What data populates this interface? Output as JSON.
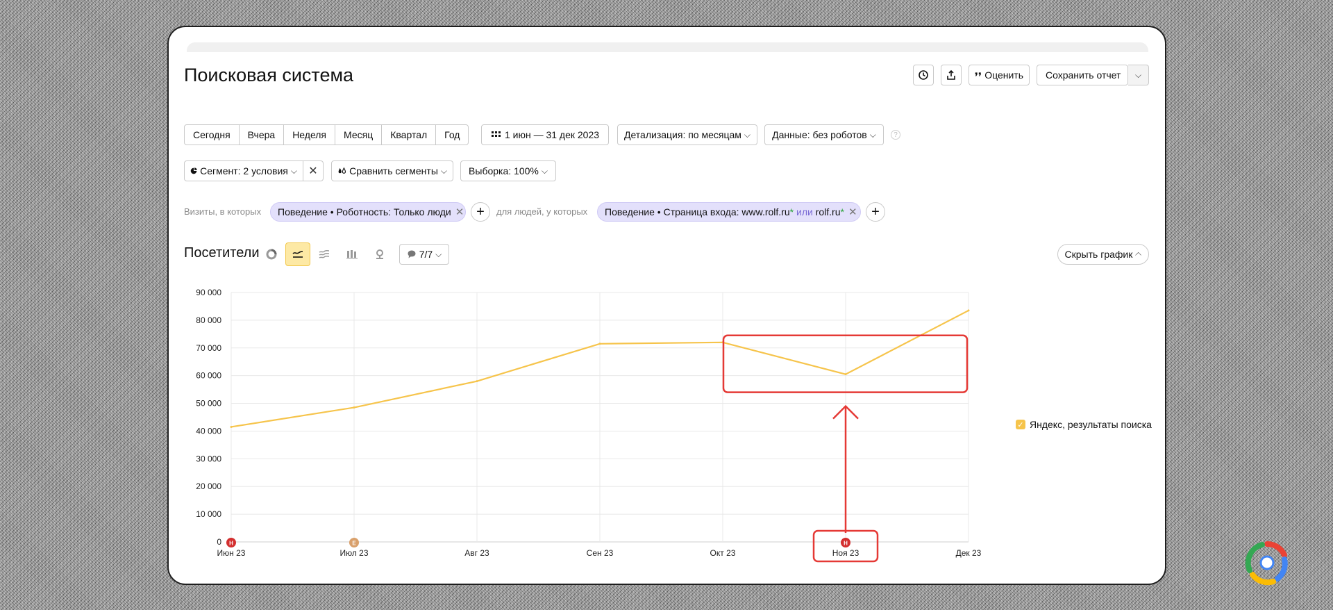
{
  "header": {
    "title": "Поисковая система",
    "rate_label": "Оценить",
    "save_label": "Сохранить отчет",
    "icons": [
      "history-icon",
      "export-icon",
      "rate-icon",
      "chevron-down-icon"
    ]
  },
  "toolbar": {
    "periods": [
      "Сегодня",
      "Вчера",
      "Неделя",
      "Месяц",
      "Квартал",
      "Год"
    ],
    "date_range": "1 июн — 31 дек 2023",
    "detail": "Детализация: по месяцам",
    "data_mode": "Данные: без роботов"
  },
  "segment": {
    "label": "Сегмент: 2 условия",
    "compare": "Сравнить сегменты",
    "sample": "Выборка: 100%"
  },
  "filters": {
    "prefix1": "Визиты, в которых",
    "chip1": "Поведение • Роботность: Только люди",
    "prefix2": "для людей, у которых",
    "chip2_a": "Поведение • Страница входа: www.rolf.ru",
    "chip2_star1": "*",
    "chip2_or": " или ",
    "chip2_b": "rolf.ru",
    "chip2_star2": "*"
  },
  "chart_section": {
    "title": "Посетители",
    "annotations_count": "7/7",
    "hide_label": "Скрыть график",
    "legend": "Яндекс, результаты поиска",
    "series_color": "#f6c44b",
    "highlight_color": "#e53935"
  },
  "chart_data": {
    "type": "line",
    "categories": [
      "Июн 23",
      "Июл 23",
      "Авг 23",
      "Сен 23",
      "Окт 23",
      "Ноя 23",
      "Дек 23"
    ],
    "y_ticks": [
      "0",
      "10 000",
      "20 000",
      "30 000",
      "40 000",
      "50 000",
      "60 000",
      "70 000",
      "80 000",
      "90 000"
    ],
    "ylim": [
      0,
      90000
    ],
    "series": [
      {
        "name": "Яндекс, результаты поиска",
        "values": [
          41500,
          48500,
          58000,
          71500,
          72000,
          60500,
          83500
        ]
      }
    ],
    "markers": [
      {
        "category": "Июн 23",
        "letter": "Н",
        "color": "#d32f2f"
      },
      {
        "category": "Июл 23",
        "letter": "Е",
        "color": "#d9a06b"
      },
      {
        "category": "Ноя 23",
        "letter": "Н",
        "color": "#d32f2f"
      }
    ],
    "grid": true,
    "legend_position": "right"
  }
}
